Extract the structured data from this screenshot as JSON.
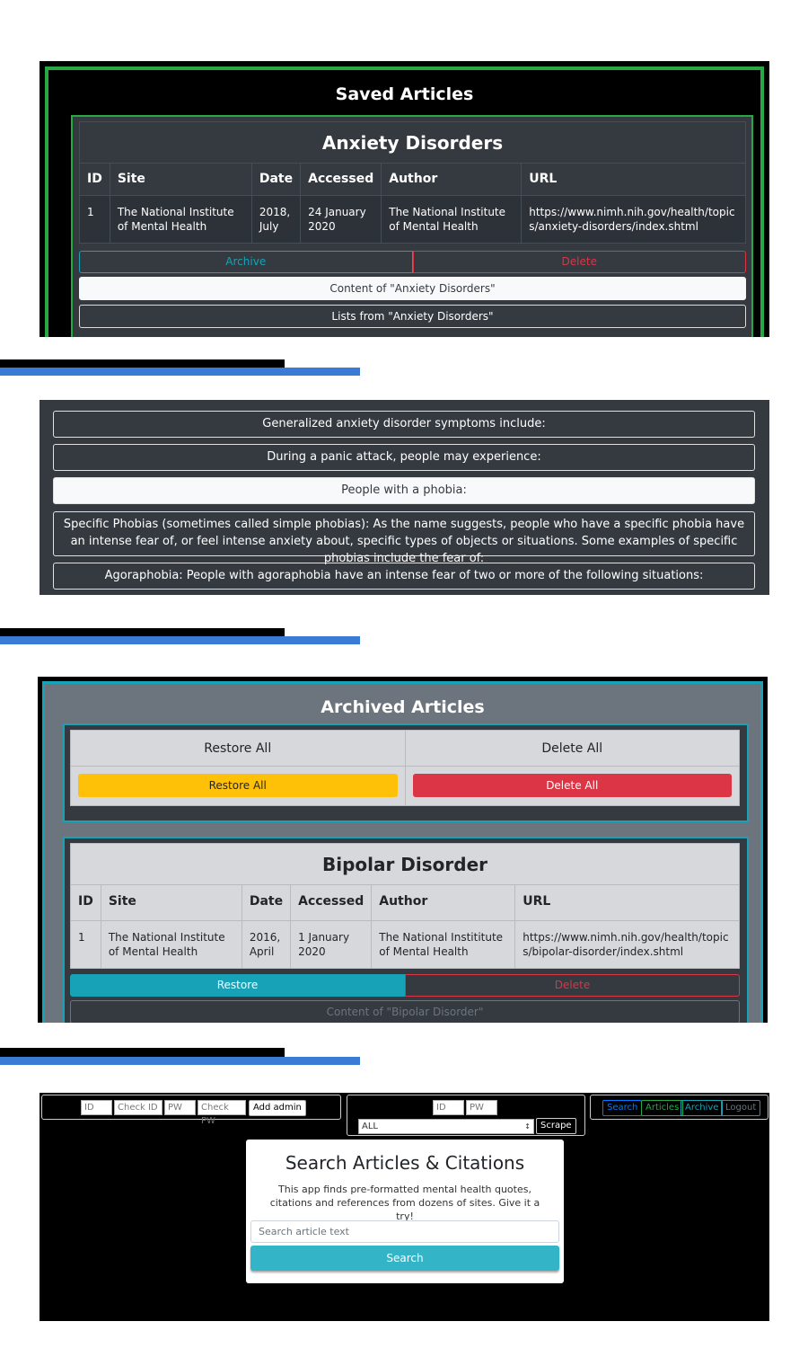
{
  "saved": {
    "title": "Saved Articles",
    "article_title": "Anxiety Disorders",
    "headers": [
      "ID",
      "Site",
      "Date",
      "Accessed",
      "Author",
      "URL"
    ],
    "row": [
      "1",
      "The National Institute of Mental Health",
      "2018, July",
      "24 January 2020",
      "The National Institute of Mental Health",
      "https://www.nimh.nih.gov/health/topics/anxiety-disorders/index.shtml"
    ],
    "archive_label": "Archive",
    "delete_label": "Delete",
    "content_label": "Content of \"Anxiety Disorders\"",
    "lists_label": "Lists from \"Anxiety Disorders\""
  },
  "lists": {
    "items": [
      "Generalized anxiety disorder symptoms include:",
      "During a panic attack, people may experience:",
      "People with a phobia:",
      "Specific Phobias (sometimes called simple phobias): As the name suggests, people who have a specific phobia have an intense fear of, or feel intense anxiety about, specific types of objects or situations. Some examples of specific phobias include the fear of:",
      "Agoraphobia: People with agoraphobia have an intense fear of two or more of the following situations:"
    ]
  },
  "archived": {
    "title": "Archived Articles",
    "restore_all_header": "Restore All",
    "delete_all_header": "Delete All",
    "restore_all_label": "Restore All",
    "delete_all_label": "Delete All",
    "article_title": "Bipolar Disorder",
    "headers": [
      "ID",
      "Site",
      "Date",
      "Accessed",
      "Author",
      "URL"
    ],
    "row": [
      "1",
      "The National Institute of Mental Health",
      "2016, April",
      "1 January 2020",
      "The National Instititute of Mental Health",
      "https://www.nimh.nih.gov/health/topics/bipolar-disorder/index.shtml"
    ],
    "restore_label": "Restore",
    "delete_label": "Delete",
    "content_label": "Content of \"Bipolar Disorder\""
  },
  "search": {
    "admin_form": {
      "id_placeholder": "ID",
      "check_id_placeholder": "Check ID",
      "pw_placeholder": "PW",
      "check_pw_placeholder": "Check PW",
      "add_admin_label": "Add admin"
    },
    "scrape_form": {
      "id_placeholder": "ID",
      "pw_placeholder": "PW",
      "select_value": "ALL",
      "scrape_label": "Scrape"
    },
    "nav": {
      "search": "Search",
      "articles": "Articles",
      "archive": "Archive",
      "logout": "Logout"
    },
    "card": {
      "heading": "Search Articles & Citations",
      "description": "This app finds pre-formatted mental health quotes, citations and references from dozens of sites. Give it a try!",
      "input_placeholder": "Search article text",
      "button_label": "Search"
    }
  },
  "colors": {
    "green": "#28a745",
    "teal": "#17a2b8",
    "red": "#dc3545",
    "yellow": "#ffc107",
    "blue": "#3a7bd5"
  }
}
